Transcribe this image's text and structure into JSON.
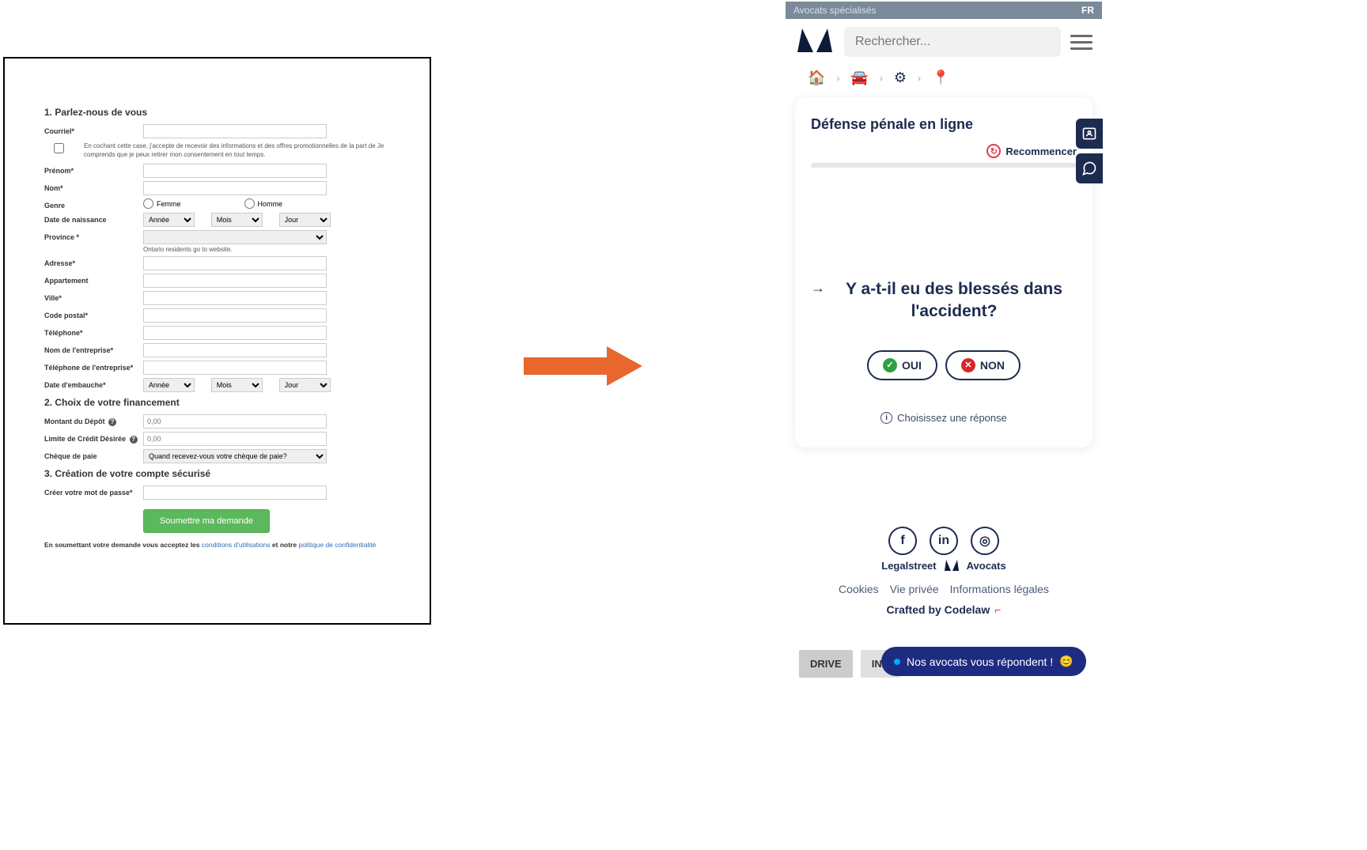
{
  "form": {
    "section1": "1. Parlez-nous de vous",
    "section2": "2. Choix de votre financement",
    "section3": "3. Création de votre compte sécurisé",
    "labels": {
      "email": "Courriel*",
      "consent": "En cochant cette case, j'accepte de recevoir des informations et des offres promotionnelles de la part de                          Je comprends que je peux retirer mon consentement en tout temps.",
      "firstname": "Prénom*",
      "lastname": "Nom*",
      "gender": "Genre",
      "female": "Femme",
      "male": "Homme",
      "dob": "Date de naissance",
      "year": "Année",
      "month": "Mois",
      "day": "Jour",
      "province": "Province *",
      "province_hint": "Ontario residents go to                          website.",
      "address": "Adresse*",
      "apartment": "Appartement",
      "city": "Ville*",
      "postal": "Code postal*",
      "phone": "Téléphone*",
      "company": "Nom de l'entreprise*",
      "company_phone": "Téléphone de l'entreprise*",
      "hire_date": "Date d'embauche*",
      "deposit": "Montant du Dépôt",
      "credit": "Limite de Crédit Désirée",
      "paycheck": "Chèque de paie",
      "paycheck_placeholder": "Quand recevez-vous votre chèque de paie?",
      "password": "Créer votre mot de passe*",
      "amount_placeholder": "0,00"
    },
    "submit": "Soumettre ma demande",
    "consent_line": {
      "prefix": "En soumettant votre demande vous acceptez les ",
      "link1": "conditions d'utilisations",
      "mid": " et notre ",
      "link2": "politique de confidentialité"
    }
  },
  "app": {
    "top_label": "Avocats spécialisés",
    "lang": "FR",
    "search_placeholder": "Rechercher...",
    "card_title": "Défense pénale en ligne",
    "restart": "Recommencer",
    "question": "Y a-t-il eu des blessés dans l'accident?",
    "yes": "OUI",
    "no": "NON",
    "choose": "Choisissez une réponse",
    "brand1": "Legalstreet",
    "brand2": "Avocats",
    "links": {
      "cookies": "Cookies",
      "privacy": "Vie privée",
      "legal": "Informations légales"
    },
    "crafted": "Crafted by Codelaw",
    "badge_drive": "DRIVE",
    "badge_ind": "IND",
    "chat": "Nos avocats vous répondent !",
    "chat_emoji": "😊"
  }
}
